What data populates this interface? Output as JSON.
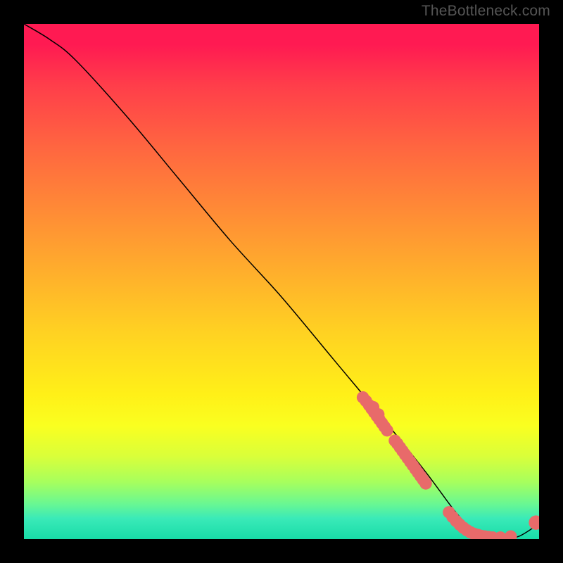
{
  "watermark": "TheBottleneck.com",
  "chart_data": {
    "type": "line",
    "title": "",
    "xlabel": "",
    "ylabel": "",
    "xlim": [
      0,
      100
    ],
    "ylim": [
      0,
      100
    ],
    "series": [
      {
        "name": "curve",
        "color": "#000000",
        "x": [
          0,
          5,
          10,
          20,
          30,
          40,
          50,
          60,
          70,
          78,
          84,
          88,
          92,
          96,
          100
        ],
        "y": [
          100,
          97,
          93,
          82,
          70,
          58,
          47,
          35,
          23,
          13,
          5,
          1,
          0,
          0.5,
          3
        ]
      }
    ],
    "markers": [
      {
        "name": "dot-cluster-upper",
        "color": "#e86a6a",
        "r": 1.2,
        "points": [
          [
            65.8,
            27.5
          ],
          [
            66.4,
            26.8
          ],
          [
            67.0,
            26.0
          ],
          [
            67.5,
            25.3
          ],
          [
            68.0,
            24.6
          ],
          [
            68.5,
            23.9
          ],
          [
            69.0,
            23.2
          ],
          [
            69.5,
            22.5
          ],
          [
            70.0,
            21.8
          ],
          [
            70.5,
            21.1
          ],
          [
            68.8,
            24.2
          ],
          [
            67.8,
            25.6
          ]
        ]
      },
      {
        "name": "dot-cluster-mid",
        "color": "#e86a6a",
        "r": 1.2,
        "points": [
          [
            72.5,
            18.5
          ],
          [
            73.0,
            17.8
          ],
          [
            73.5,
            17.1
          ],
          [
            74.0,
            16.4
          ],
          [
            74.5,
            15.7
          ],
          [
            75.0,
            15.0
          ],
          [
            75.5,
            14.3
          ],
          [
            76.0,
            13.6
          ],
          [
            76.5,
            12.9
          ],
          [
            77.0,
            12.2
          ],
          [
            77.5,
            11.5
          ],
          [
            78.0,
            10.8
          ],
          [
            72.0,
            19.1
          ]
        ]
      },
      {
        "name": "dot-cluster-bottom",
        "color": "#e86a6a",
        "r": 1.2,
        "points": [
          [
            82.5,
            5.2
          ],
          [
            83.2,
            4.3
          ],
          [
            83.9,
            3.5
          ],
          [
            84.6,
            2.8
          ],
          [
            85.3,
            2.2
          ],
          [
            86.0,
            1.7
          ],
          [
            86.7,
            1.3
          ],
          [
            87.4,
            1.0
          ],
          [
            88.1,
            0.8
          ],
          [
            88.8,
            0.6
          ],
          [
            89.5,
            0.5
          ],
          [
            90.2,
            0.4
          ],
          [
            91.0,
            0.3
          ],
          [
            92.5,
            0.3
          ],
          [
            94.5,
            0.5
          ]
        ]
      },
      {
        "name": "dot-end",
        "color": "#e86a6a",
        "r": 1.4,
        "points": [
          [
            99.4,
            3.2
          ]
        ]
      }
    ]
  }
}
